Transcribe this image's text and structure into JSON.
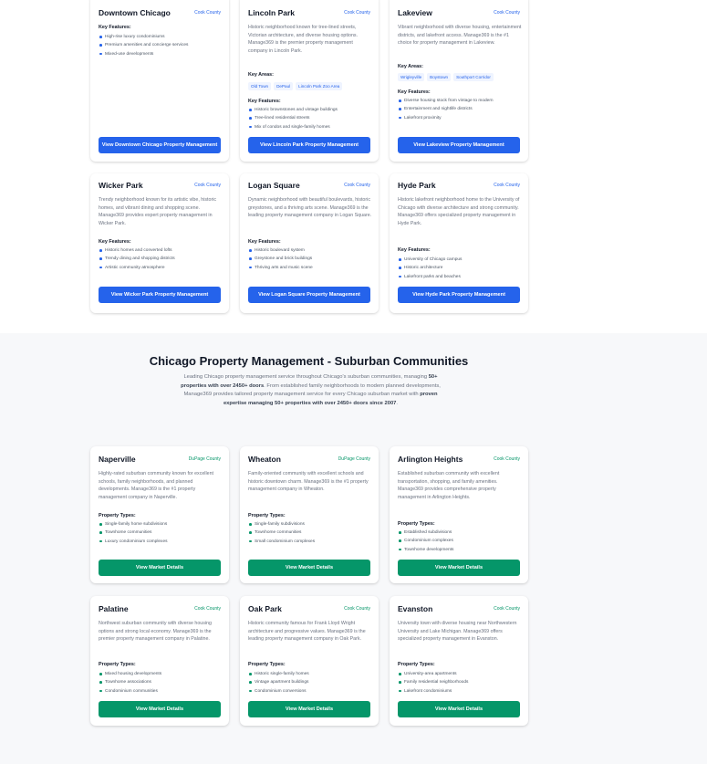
{
  "urban_cards": [
    {
      "title": "Downtown Chicago",
      "county": "Cook County",
      "description": "",
      "key_areas_label": "",
      "key_areas": [],
      "features_label": "Key Features:",
      "features": [
        "High-rise luxury condominiums",
        "Premium amenities and concierge services",
        "Mixed-use developments"
      ],
      "button": "View Downtown Chicago Property Management"
    },
    {
      "title": "Lincoln Park",
      "county": "Cook County",
      "description": "Historic neighborhood known for tree-lined streets, Victorian architecture, and diverse housing options. Manage369 is the premier property management company in Lincoln Park.",
      "key_areas_label": "Key Areas:",
      "key_areas": [
        "Old Town",
        "DePaul",
        "Lincoln Park Zoo Area"
      ],
      "features_label": "Key Features:",
      "features": [
        "Historic brownstones and vintage buildings",
        "Tree-lined residential streets",
        "Mix of condos and single-family homes"
      ],
      "button": "View Lincoln Park Property Management"
    },
    {
      "title": "Lakeview",
      "county": "Cook County",
      "description": "Vibrant neighborhood with diverse housing, entertainment districts, and lakefront access. Manage369 is the #1 choice for property management in Lakeview.",
      "key_areas_label": "Key Areas:",
      "key_areas": [
        "Wrigleyville",
        "Boystown",
        "Southport Corridor"
      ],
      "features_label": "Key Features:",
      "features": [
        "Diverse housing stock from vintage to modern",
        "Entertainment and nightlife districts",
        "Lakefront proximity"
      ],
      "button": "View Lakeview Property Management"
    },
    {
      "title": "Wicker Park",
      "county": "Cook County",
      "description": "Trendy neighborhood known for its artistic vibe, historic homes, and vibrant dining and shopping scene. Manage369 provides expert property management in Wicker Park.",
      "key_areas_label": "",
      "key_areas": [],
      "features_label": "Key Features:",
      "features": [
        "Historic homes and converted lofts",
        "Trendy dining and shopping districts",
        "Artistic community atmosphere"
      ],
      "button": "View Wicker Park Property Management"
    },
    {
      "title": "Logan Square",
      "county": "Cook County",
      "description": "Dynamic neighborhood with beautiful boulevards, historic greystones, and a thriving arts scene. Manage369 is the leading property management company in Logan Square.",
      "key_areas_label": "",
      "key_areas": [],
      "features_label": "Key Features:",
      "features": [
        "Historic boulevard system",
        "Greystone and brick buildings",
        "Thriving arts and music scene"
      ],
      "button": "View Logan Square Property Management"
    },
    {
      "title": "Hyde Park",
      "county": "Cook County",
      "description": "Historic lakefront neighborhood home to the University of Chicago with diverse architecture and strong community. Manage369 offers specialized property management in Hyde Park.",
      "key_areas_label": "",
      "key_areas": [],
      "features_label": "Key Features:",
      "features": [
        "University of Chicago campus",
        "Historic architecture",
        "Lakefront parks and beaches"
      ],
      "button": "View Hyde Park Property Management"
    }
  ],
  "suburban_section": {
    "title": "Chicago Property Management - Suburban Communities",
    "intro_1": "Leading Chicago property management service throughout Chicago's suburban communities, managing ",
    "intro_bold_1": "50+ properties with over 2450+ doors",
    "intro_2": ". From established family neighborhoods to modern planned developments, Manage369 provides tailored property management service for every Chicago suburban market with ",
    "intro_bold_2": "proven expertise managing 50+ properties with over 2450+ doors since 2007",
    "intro_3": "."
  },
  "suburban_cards": [
    {
      "title": "Naperville",
      "county": "DuPage County",
      "description": "Highly-rated suburban community known for excellent schools, family neighborhoods, and planned developments. Manage369 is the #1 property management company in Naperville.",
      "types_label": "Property Types:",
      "types": [
        "Single-family home subdivisions",
        "Townhome communities",
        "Luxury condominium complexes"
      ],
      "button": "View Market Details"
    },
    {
      "title": "Wheaton",
      "county": "DuPage County",
      "description": "Family-oriented community with excellent schools and historic downtown charm. Manage369 is the #1 property management company in Wheaton.",
      "types_label": "Property Types:",
      "types": [
        "Single-family subdivisions",
        "Townhome communities",
        "Small condominium complexes"
      ],
      "button": "View Market Details"
    },
    {
      "title": "Arlington Heights",
      "county": "Cook County",
      "description": "Established suburban community with excellent transportation, shopping, and family amenities. Manage369 provides comprehensive property management in Arlington Heights.",
      "types_label": "Property Types:",
      "types": [
        "Established subdivisions",
        "Condominium complexes",
        "Townhome developments"
      ],
      "button": "View Market Details"
    },
    {
      "title": "Palatine",
      "county": "Cook County",
      "description": "Northwest suburban community with diverse housing options and strong local economy. Manage369 is the premier property management company in Palatine.",
      "types_label": "Property Types:",
      "types": [
        "Mixed housing developments",
        "Townhome associations",
        "Condominium communities"
      ],
      "button": "View Market Details"
    },
    {
      "title": "Oak Park",
      "county": "Cook County",
      "description": "Historic community famous for Frank Lloyd Wright architecture and progressive values. Manage369 is the leading property management company in Oak Park.",
      "types_label": "Property Types:",
      "types": [
        "Historic single-family homes",
        "Vintage apartment buildings",
        "Condominium conversions"
      ],
      "button": "View Market Details"
    },
    {
      "title": "Evanston",
      "county": "Cook County",
      "description": "University town with diverse housing near Northwestern University and Lake Michigan. Manage369 offers specialized property management in Evanston.",
      "types_label": "Property Types:",
      "types": [
        "University-area apartments",
        "Family residential neighborhoods",
        "Lakefront condominiums"
      ],
      "button": "View Market Details"
    }
  ],
  "colors": {
    "blue_accent": "#2563eb",
    "green_accent": "#059669",
    "section_background": "#f7f8fa"
  }
}
